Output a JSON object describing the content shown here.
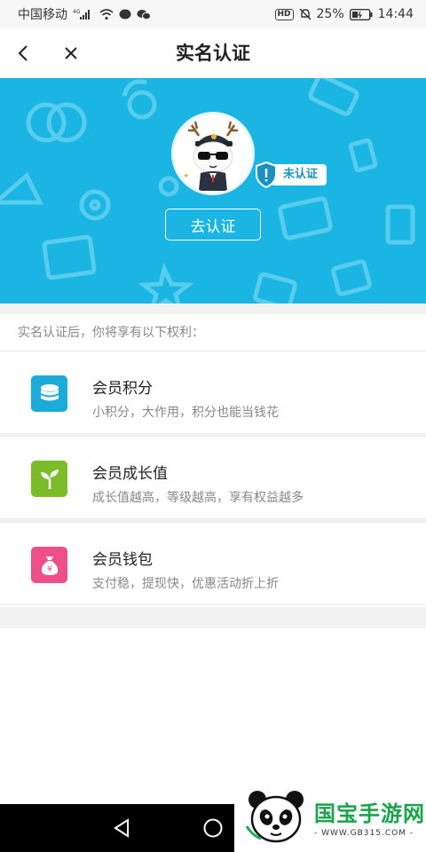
{
  "status_bar": {
    "carrier": "中国移动",
    "network": "4G",
    "battery_percent": "25%",
    "time": "14:44",
    "hd_label": "HD",
    "icons": [
      "signal-icon",
      "wifi-icon",
      "message-icon",
      "wechat-icon",
      "mute-icon",
      "battery-icon"
    ]
  },
  "header": {
    "title": "实名认证",
    "back_icon": "chevron-left-icon",
    "close_icon": "close-icon"
  },
  "banner": {
    "background_color": "#1ab5e2",
    "verification_status": "未认证",
    "verify_button_label": "去认证",
    "avatar": "cartoon-deer-mascot"
  },
  "benefits": {
    "heading": "实名认证后，你将享有以下权利：",
    "items": [
      {
        "title": "会员积分",
        "description": "小积分，大作用，积分也能当钱花",
        "icon": "coins-stack-icon",
        "color": "#1aabd8"
      },
      {
        "title": "会员成长值",
        "description": "成长值越高，等级越高，享有权益越多",
        "icon": "sprout-icon",
        "color": "#7cbb2a"
      },
      {
        "title": "会员钱包",
        "description": "支付稳，提现快，优惠活动折上折",
        "icon": "money-bag-icon",
        "color": "#ee4f86"
      }
    ]
  },
  "nav_bar": {
    "icons": [
      "nav-back-icon",
      "nav-home-icon"
    ]
  },
  "watermark": {
    "brand": "国宝手游网",
    "url": "- WWW.GB315.COM -"
  }
}
